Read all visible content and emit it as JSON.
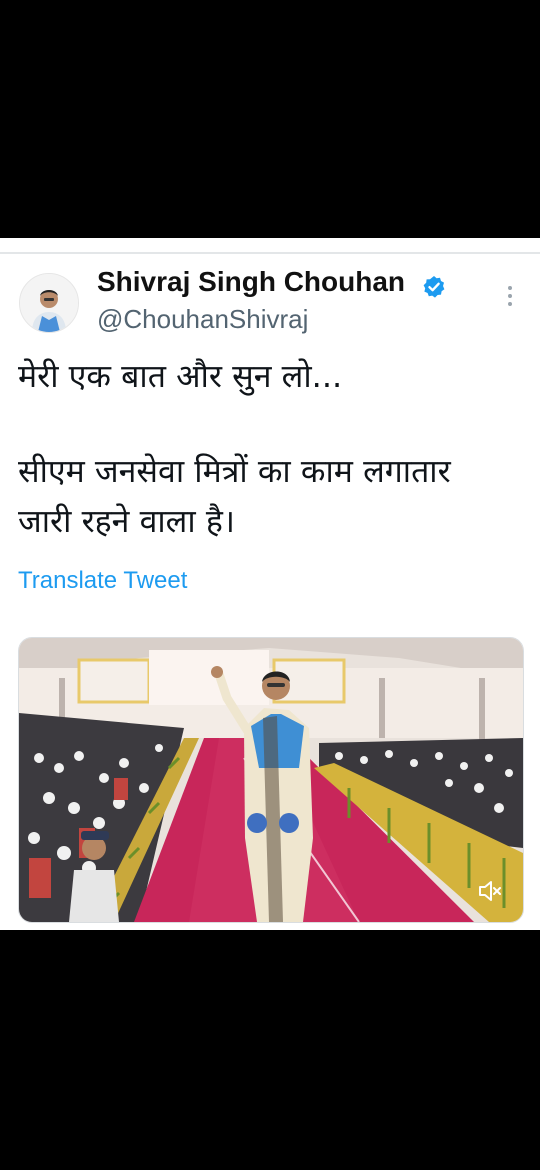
{
  "tweet": {
    "display_name": "Shivraj Singh Chouhan",
    "handle": "@ChouhanShivraj",
    "text_line_1": "मेरी एक बात और सुन लो...",
    "text_line_2": "सीएम जनसेवा मित्रों का काम लगातार",
    "text_line_3": "जारी रहने वाला है।",
    "translate_label": "Translate Tweet"
  },
  "icons": {
    "avatar": "profile-photo",
    "verified": "verified-badge-icon",
    "more": "more-vertical-icon",
    "media_mute": "speaker-muted-icon"
  },
  "colors": {
    "link": "#1d9bf0",
    "verified": "#1d9bf0",
    "handle": "#536471",
    "background": "#000000"
  }
}
